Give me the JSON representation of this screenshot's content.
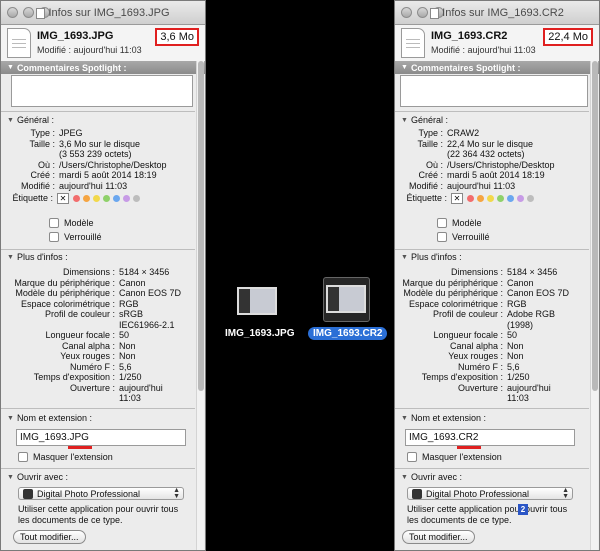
{
  "left": {
    "title": "Infos sur IMG_1693.JPG",
    "filename": "IMG_1693.JPG",
    "size": "3,6 Mo",
    "modified_label": "Modifié :",
    "modified_value": "aujourd'hui 11:03",
    "spotlight_label": "Commentaires Spotlight :",
    "general_label": "Général :",
    "general": [
      {
        "label": "Type :",
        "value": "JPEG"
      },
      {
        "label": "Taille :",
        "value": "3,6 Mo sur le disque"
      },
      {
        "label": "",
        "value": "(3 553 239 octets)"
      },
      {
        "label": "Où :",
        "value": "/Users/Christophe/Desktop"
      },
      {
        "label": "Créé :",
        "value": "mardi 5 août 2014 18:19"
      },
      {
        "label": "Modifié :",
        "value": "aujourd'hui 11:03"
      }
    ],
    "etiquette_label": "Étiquette :",
    "modele": "Modèle",
    "verrouille": "Verrouillé",
    "more_label": "Plus d'infos :",
    "more": [
      {
        "label": "Dimensions :",
        "value": "5184 × 3456"
      },
      {
        "label": "Marque du périphérique :",
        "value": "Canon"
      },
      {
        "label": "Modèle du périphérique :",
        "value": "Canon EOS 7D"
      },
      {
        "label": "Espace colorimétrique :",
        "value": "RGB"
      },
      {
        "label": "Profil de couleur :",
        "value": "sRGB"
      },
      {
        "label": "",
        "value": "IEC61966-2.1"
      },
      {
        "label": "Longueur focale :",
        "value": "50"
      },
      {
        "label": "Canal alpha :",
        "value": "Non"
      },
      {
        "label": "Yeux rouges :",
        "value": "Non"
      },
      {
        "label": "Numéro F :",
        "value": "5,6"
      },
      {
        "label": "Temps d'exposition :",
        "value": "1/250"
      },
      {
        "label": "Ouverture :",
        "value": "aujourd'hui"
      },
      {
        "label": "",
        "value": "11:03"
      }
    ],
    "name_label": "Nom et extension :",
    "name_base": "IMG_1693",
    "name_ext": ".JPG",
    "hide_ext": "Masquer l'extension",
    "open_with_label": "Ouvrir avec :",
    "app": "Digital Photo Professional",
    "use_app": "Utiliser cette application pour ouvrir tous les documents de ce type.",
    "change_all": "Tout modifier..."
  },
  "right": {
    "title": "Infos sur IMG_1693.CR2",
    "filename": "IMG_1693.CR2",
    "size": "22,4 Mo",
    "modified_label": "Modifié :",
    "modified_value": "aujourd'hui 11:03",
    "spotlight_label": "Commentaires Spotlight :",
    "general_label": "Général :",
    "general": [
      {
        "label": "Type :",
        "value": "CRAW2"
      },
      {
        "label": "Taille :",
        "value": "22,4 Mo sur le disque"
      },
      {
        "label": "",
        "value": "(22 364 432 octets)"
      },
      {
        "label": "Où :",
        "value": "/Users/Christophe/Desktop"
      },
      {
        "label": "Créé :",
        "value": "mardi 5 août 2014 18:19"
      },
      {
        "label": "Modifié :",
        "value": "aujourd'hui 11:03"
      }
    ],
    "etiquette_label": "Étiquette :",
    "modele": "Modèle",
    "verrouille": "Verrouillé",
    "more_label": "Plus d'infos :",
    "more": [
      {
        "label": "Dimensions :",
        "value": "5184 × 3456"
      },
      {
        "label": "Marque du périphérique :",
        "value": "Canon"
      },
      {
        "label": "Modèle du périphérique :",
        "value": "Canon EOS 7D"
      },
      {
        "label": "Espace colorimétrique :",
        "value": "RGB"
      },
      {
        "label": "Profil de couleur :",
        "value": "Adobe RGB"
      },
      {
        "label": "",
        "value": "(1998)"
      },
      {
        "label": "Longueur focale :",
        "value": "50"
      },
      {
        "label": "Canal alpha :",
        "value": "Non"
      },
      {
        "label": "Yeux rouges :",
        "value": "Non"
      },
      {
        "label": "Numéro F :",
        "value": "5,6"
      },
      {
        "label": "Temps d'exposition :",
        "value": "1/250"
      },
      {
        "label": "Ouverture :",
        "value": "aujourd'hui"
      },
      {
        "label": "",
        "value": "11:03"
      }
    ],
    "name_label": "Nom et extension :",
    "name_base": "IMG_1693",
    "name_ext": ".CR2",
    "hide_ext": "Masquer l'extension",
    "open_with_label": "Ouvrir avec :",
    "app": "Digital Photo Professional",
    "use_app": "Utiliser cette application pour ouvrir tous les documents de ce type.",
    "change_all": "Tout modifier...",
    "badge": "2"
  },
  "desktop": {
    "jpg_label": "IMG_1693.JPG",
    "cr2_label": "IMG_1693.CR2"
  },
  "colors": {
    "highlight_red": "#e02020",
    "selection_blue": "#2b6fd6",
    "tag_colors": [
      "#f26d6d",
      "#f5a542",
      "#f2d84b",
      "#8fd16a",
      "#6ba7ef",
      "#c79be6",
      "#bdbdbd"
    ]
  },
  "icons": {
    "window_icon": "document-icon",
    "image_icon": "photo-thumbnail-icon",
    "app_icon": "camera-icon"
  }
}
